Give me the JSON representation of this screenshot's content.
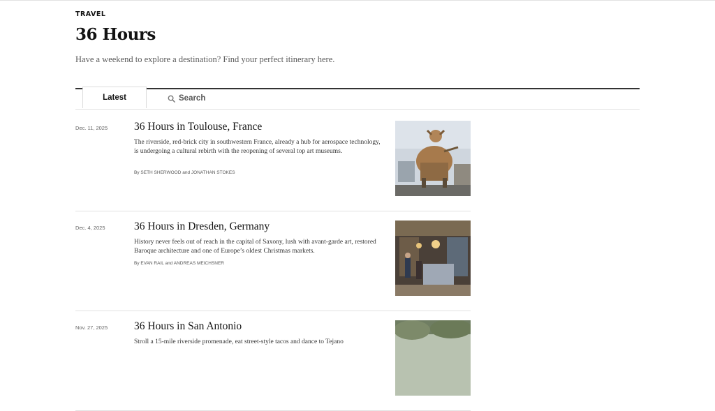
{
  "header": {
    "section": "Travel",
    "title": "36 Hours",
    "subtitle": "Have a weekend to explore a destination? Find your perfect itinerary here."
  },
  "tabs": {
    "latest": "Latest",
    "search": "Search"
  },
  "articles": [
    {
      "date": "Dec. 11, 2025",
      "title": "36 Hours in Toulouse, France",
      "summary": "The riverside, red-brick city in southwestern France, already a hub for aerospace technology, is undergoing a cultural rebirth with the reopening of several top art museums.",
      "byline_prefix": "By",
      "author1": "Seth Sherwood",
      "byline_and": "and",
      "author2": "Jonathan Stokes"
    },
    {
      "date": "Dec. 4, 2025",
      "title": "36 Hours in Dresden, Germany",
      "summary": "History never feels out of reach in the capital of Saxony, lush with avant-garde art, restored Baroque architecture and one of Europe’s oldest Christmas markets.",
      "byline_prefix": "By",
      "author1": "Evan Rail",
      "byline_and": "and",
      "author2": "Andreas Meichsner"
    },
    {
      "date": "Nov. 27, 2025",
      "title": "36 Hours in San Antonio",
      "summary": "Stroll a 15-mile riverside promenade, eat street-style tacos and dance to Tejano",
      "byline_prefix": "",
      "author1": "",
      "byline_and": "",
      "author2": ""
    }
  ]
}
